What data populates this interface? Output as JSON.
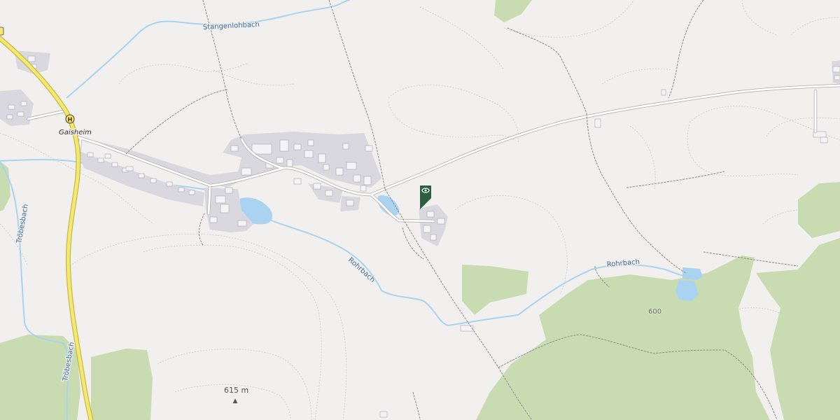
{
  "map": {
    "colors": {
      "background": "#f1f0ee",
      "forest": "#c9dcb1",
      "water": "#a9d3f0",
      "stream": "#a9d3ee",
      "settlement": "#d9d8de",
      "building": "#f4f4f6",
      "road_casing": "#b3b3b3",
      "major_road": "#f5e86f",
      "track": "#8a8a8a",
      "contour": "#d1cfcc",
      "poi_marker": "#2c5f3f"
    },
    "labels": {
      "stream_stangenlohbach": "Stangenlohbach",
      "stream_rohrbach_1": "Rohrbach",
      "stream_rohrbach_2": "Rohrbach",
      "stream_troebesbach_1": "Tröbesbach",
      "stream_troebesbach_2": "Tröbesbach",
      "village_gaisheim": "Gaisheim",
      "elevation_600": "600",
      "peak_615": "615 m",
      "bus_stop_icon": "H"
    },
    "peak_symbol": "▲",
    "markers": {
      "poi": "viewpoint-icon",
      "bus_stop": "bus-stop-icon",
      "peak": "peak-icon"
    }
  }
}
